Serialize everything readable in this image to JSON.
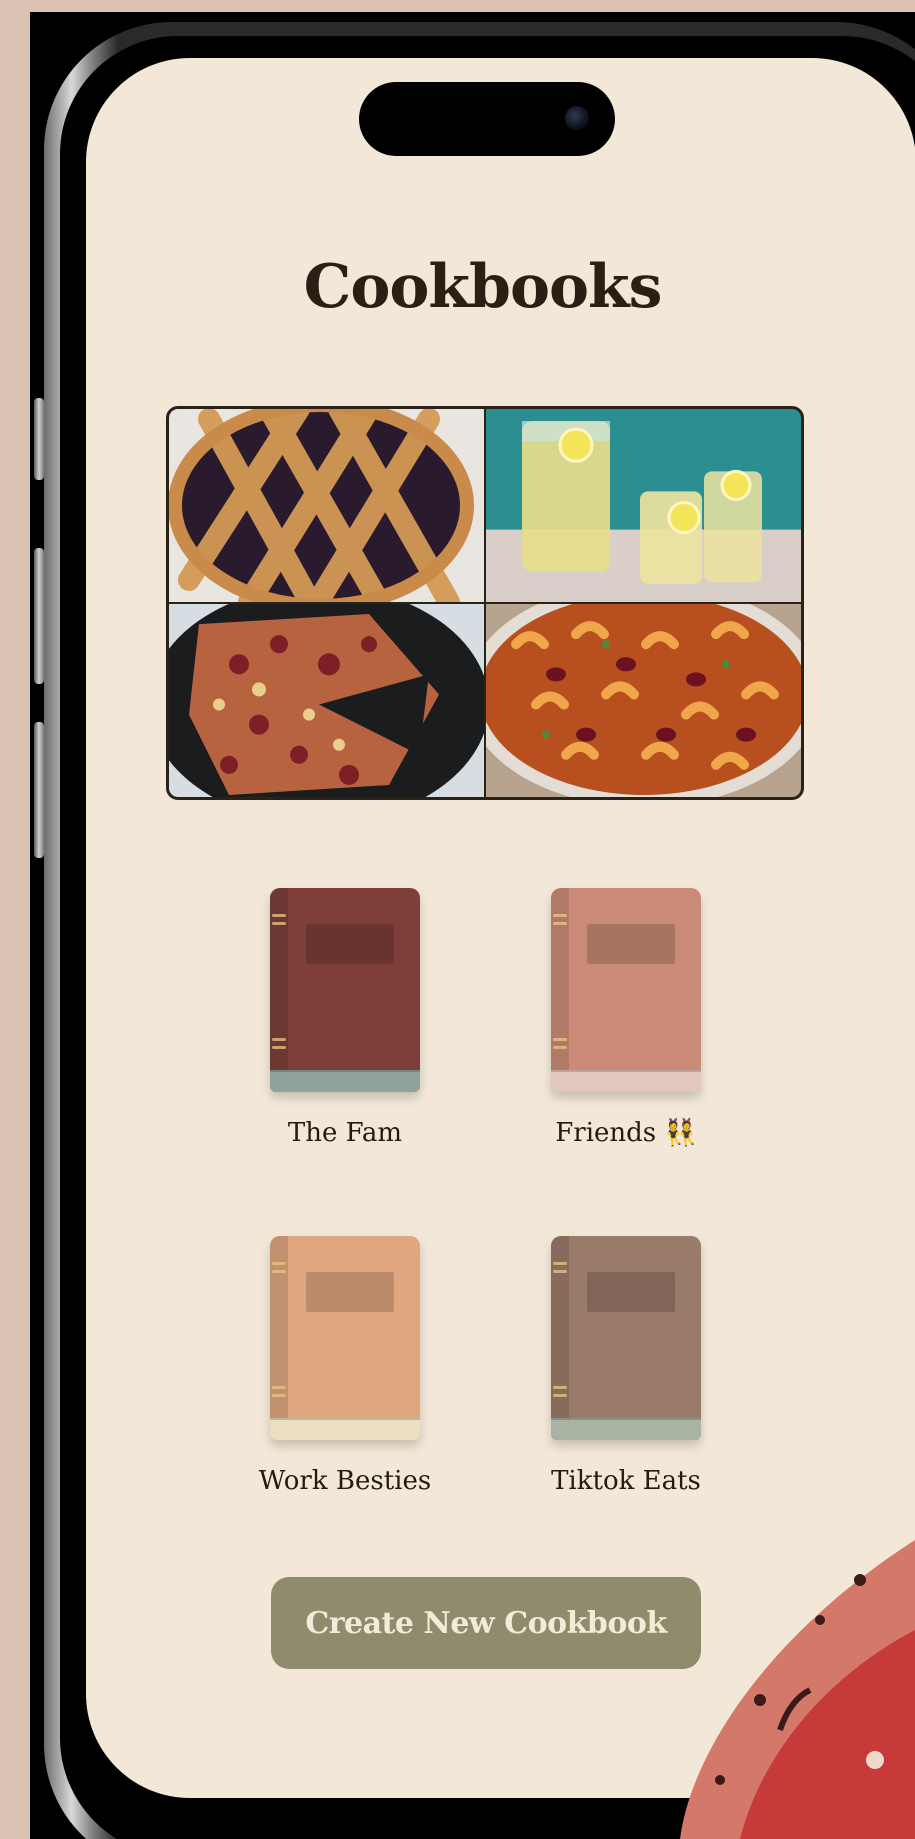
{
  "page": {
    "title": "Cookbooks"
  },
  "collage": {
    "images": [
      {
        "name": "lattice-pie",
        "alt": "Lattice berry pie"
      },
      {
        "name": "lemonade",
        "alt": "Glasses of lemonade"
      },
      {
        "name": "skillet-pizza",
        "alt": "Skillet pizza"
      },
      {
        "name": "chili-mac",
        "alt": "Chili mac"
      }
    ]
  },
  "cookbooks": [
    {
      "label": "The Fam",
      "color": "#7e3f3a",
      "pages_color": "#8fa39b"
    },
    {
      "label": "Friends 👯",
      "color": "#c98a77",
      "pages_color": "#e2c7bd"
    },
    {
      "label": "Work Besties",
      "color": "#dfa680",
      "pages_color": "#eadfc1"
    },
    {
      "label": "Tiktok Eats",
      "color": "#9a7a68",
      "pages_color": "#a9b3a3"
    }
  ],
  "actions": {
    "create_label": "Create New Cookbook"
  },
  "colors": {
    "screen_bg": "#f3e8d8",
    "button_bg": "#8f8c6e",
    "title": "#2b1f15",
    "backdrop": "#dcc2b2"
  }
}
